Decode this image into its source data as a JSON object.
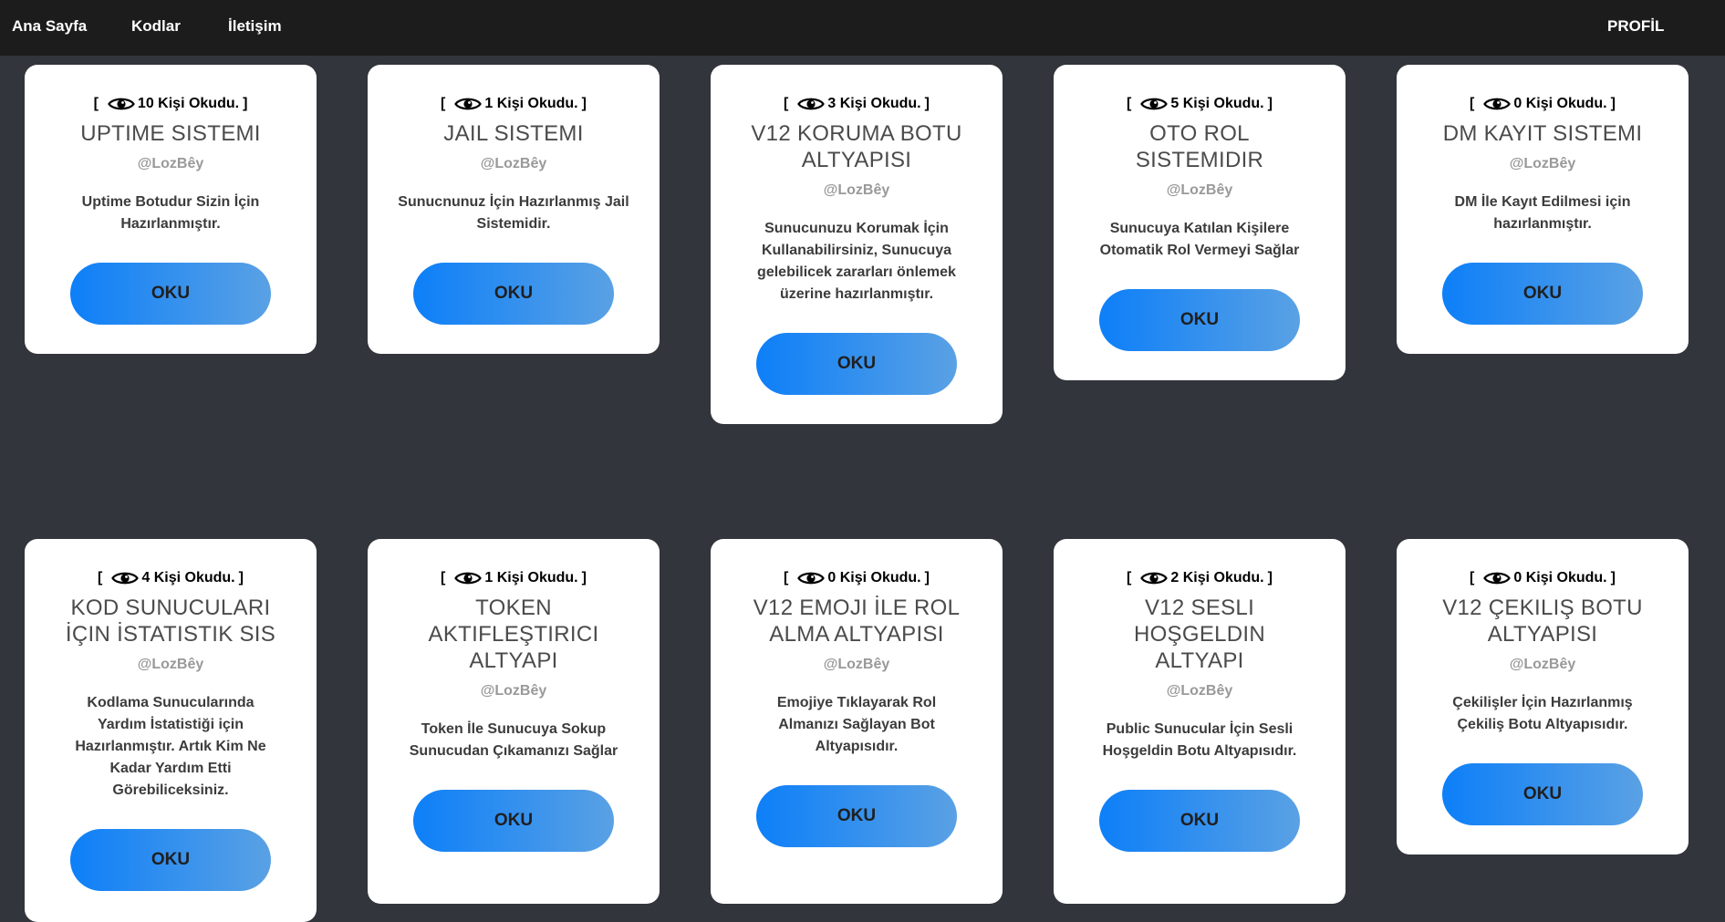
{
  "nav": {
    "home": "Ana Sayfa",
    "codes": "Kodlar",
    "contact": "İletişim",
    "profile": "PROFİL"
  },
  "cards": [
    {
      "views": "10 Kişi Okudu.",
      "title": "UPTIME SISTEMI",
      "author": "@LozBêy",
      "desc": "Uptime Botudur Sizin İçin Hazırlanmıştır.",
      "button": "OKU"
    },
    {
      "views": "1 Kişi Okudu.",
      "title": "JAIL SISTEMI",
      "author": "@LozBêy",
      "desc": "Sunucnunuz İçin Hazırlanmış Jail Sistemidir.",
      "button": "OKU"
    },
    {
      "views": "3 Kişi Okudu.",
      "title": "V12 KORUMA BOTU ALTYAPISI",
      "author": "@LozBêy",
      "desc": "Sunucunuzu Korumak İçin Kullanabilirsiniz, Sunucuya gelebilicek zararları önlemek üzerine hazırlanmıştır.",
      "button": "OKU"
    },
    {
      "views": "5 Kişi Okudu.",
      "title": "OTO ROL SISTEMIDIR",
      "author": "@LozBêy",
      "desc": "Sunucuya Katılan Kişilere Otomatik Rol Vermeyi Sağlar",
      "button": "OKU"
    },
    {
      "views": "0 Kişi Okudu.",
      "title": "DM KAYIT SISTEMI",
      "author": "@LozBêy",
      "desc": "DM İle Kayıt Edilmesi için hazırlanmıştır.",
      "button": "OKU"
    },
    {
      "views": "4 Kişi Okudu.",
      "title": "KOD SUNUCULARI İÇIN İSTATISTIK SIS",
      "author": "@LozBêy",
      "desc": "Kodlama Sunucularında Yardım İstatistiği için Hazırlanmıştır. Artık Kim Ne Kadar Yardım Etti Görebiliceksiniz.",
      "button": "OKU"
    },
    {
      "views": "1 Kişi Okudu.",
      "title": "TOKEN AKTIFLEŞTIRICI ALTYAPI",
      "author": "@LozBêy",
      "desc": "Token İle Sunucuya Sokup Sunucudan Çıkamanızı Sağlar",
      "button": "OKU"
    },
    {
      "views": "0 Kişi Okudu.",
      "title": "V12 EMOJI İLE ROL ALMA ALTYAPISI",
      "author": "@LozBêy",
      "desc": "Emojiye Tıklayarak Rol Almanızı Sağlayan Bot Altyapısıdır.",
      "button": "OKU"
    },
    {
      "views": "2 Kişi Okudu.",
      "title": "V12 SESLI HOŞGELDIN ALTYAPI",
      "author": "@LozBêy",
      "desc": "Public Sunucular İçin Sesli Hoşgeldin Botu Altyapısıdır.",
      "button": "OKU"
    },
    {
      "views": "0 Kişi Okudu.",
      "title": "V12 ÇEKILIŞ BOTU ALTYAPISI",
      "author": "@LozBêy",
      "desc": "Çekilişler İçin Hazırlanmış Çekiliş Botu Altyapısıdır.",
      "button": "OKU"
    }
  ],
  "colors": {
    "background": "#32353b",
    "navbar": "#1c1c1c",
    "button_start": "#0d7ff8",
    "button_end": "#5aa1e4"
  },
  "icons": {
    "views": "eye-icon"
  }
}
